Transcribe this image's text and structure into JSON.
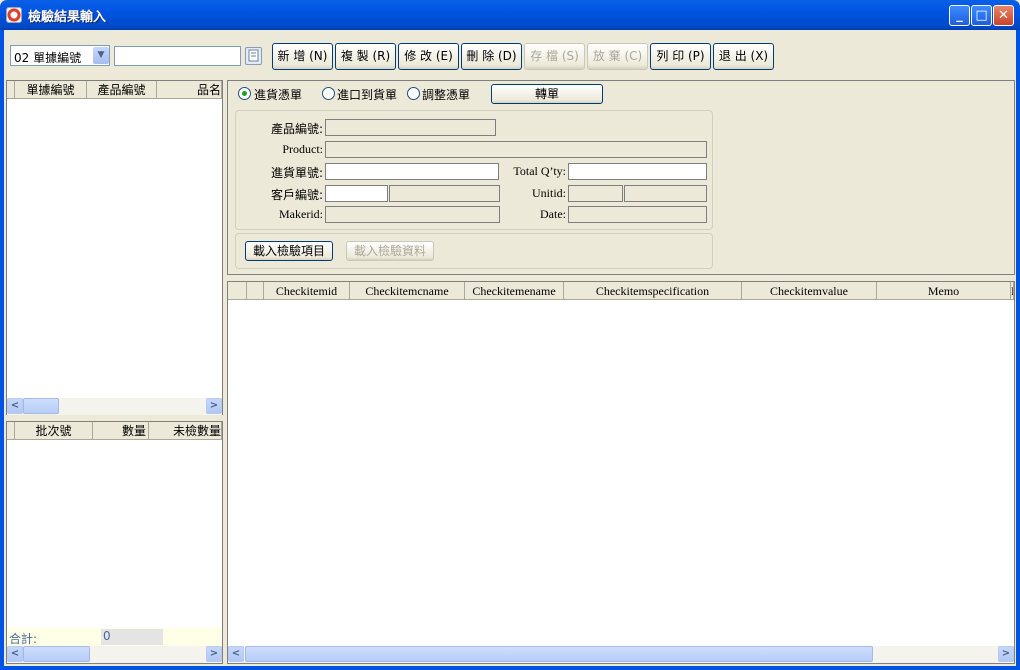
{
  "window": {
    "title": "檢驗結果輸入",
    "controls": {
      "minimize": "_",
      "maximize": "□",
      "close": "✕"
    }
  },
  "toolbar": {
    "doc_type_select": {
      "value": "02 單據編號"
    },
    "search": {
      "value": "",
      "placeholder": ""
    },
    "buttons": {
      "add": "新 增 (N)",
      "copy": "複 製 (R)",
      "edit": "修 改 (E)",
      "delete": "刪 除 (D)",
      "save": "存 檔 (S)",
      "discard": "放 棄 (C)",
      "print": "列 印 (P)",
      "exit": "退 出 (X)"
    }
  },
  "left_top_grid": {
    "columns": [
      "單據編號",
      "產品編號",
      "品名"
    ]
  },
  "left_bottom_grid": {
    "columns": [
      "批次號",
      "數量",
      "未檢數量"
    ],
    "total_label": "合計:",
    "total_value": "0"
  },
  "form": {
    "radios": [
      {
        "label": "進貨憑單",
        "selected": true
      },
      {
        "label": "進口到貨單",
        "selected": false
      },
      {
        "label": "調整憑單",
        "selected": false
      }
    ],
    "convert_button": "轉單",
    "fields": {
      "product_no": "產品編號:",
      "product": "Product:",
      "purchase_no": "進貨單號:",
      "total_qty": "Total Q’ty:",
      "customer_no": "客戶編號:",
      "unitid": "Unitid:",
      "makerid": "Makerid:",
      "date": "Date:"
    },
    "load_items_button": "載入檢驗項目",
    "load_data_button": "載入檢驗資料"
  },
  "check_grid": {
    "columns": [
      "Checkitemid",
      "Checkitemcname",
      "Checkitemename",
      "Checkitemspecification",
      "Checkitemvalue",
      "Memo",
      "M"
    ]
  },
  "scroll_glyphs": {
    "left": "<",
    "right": ">"
  }
}
